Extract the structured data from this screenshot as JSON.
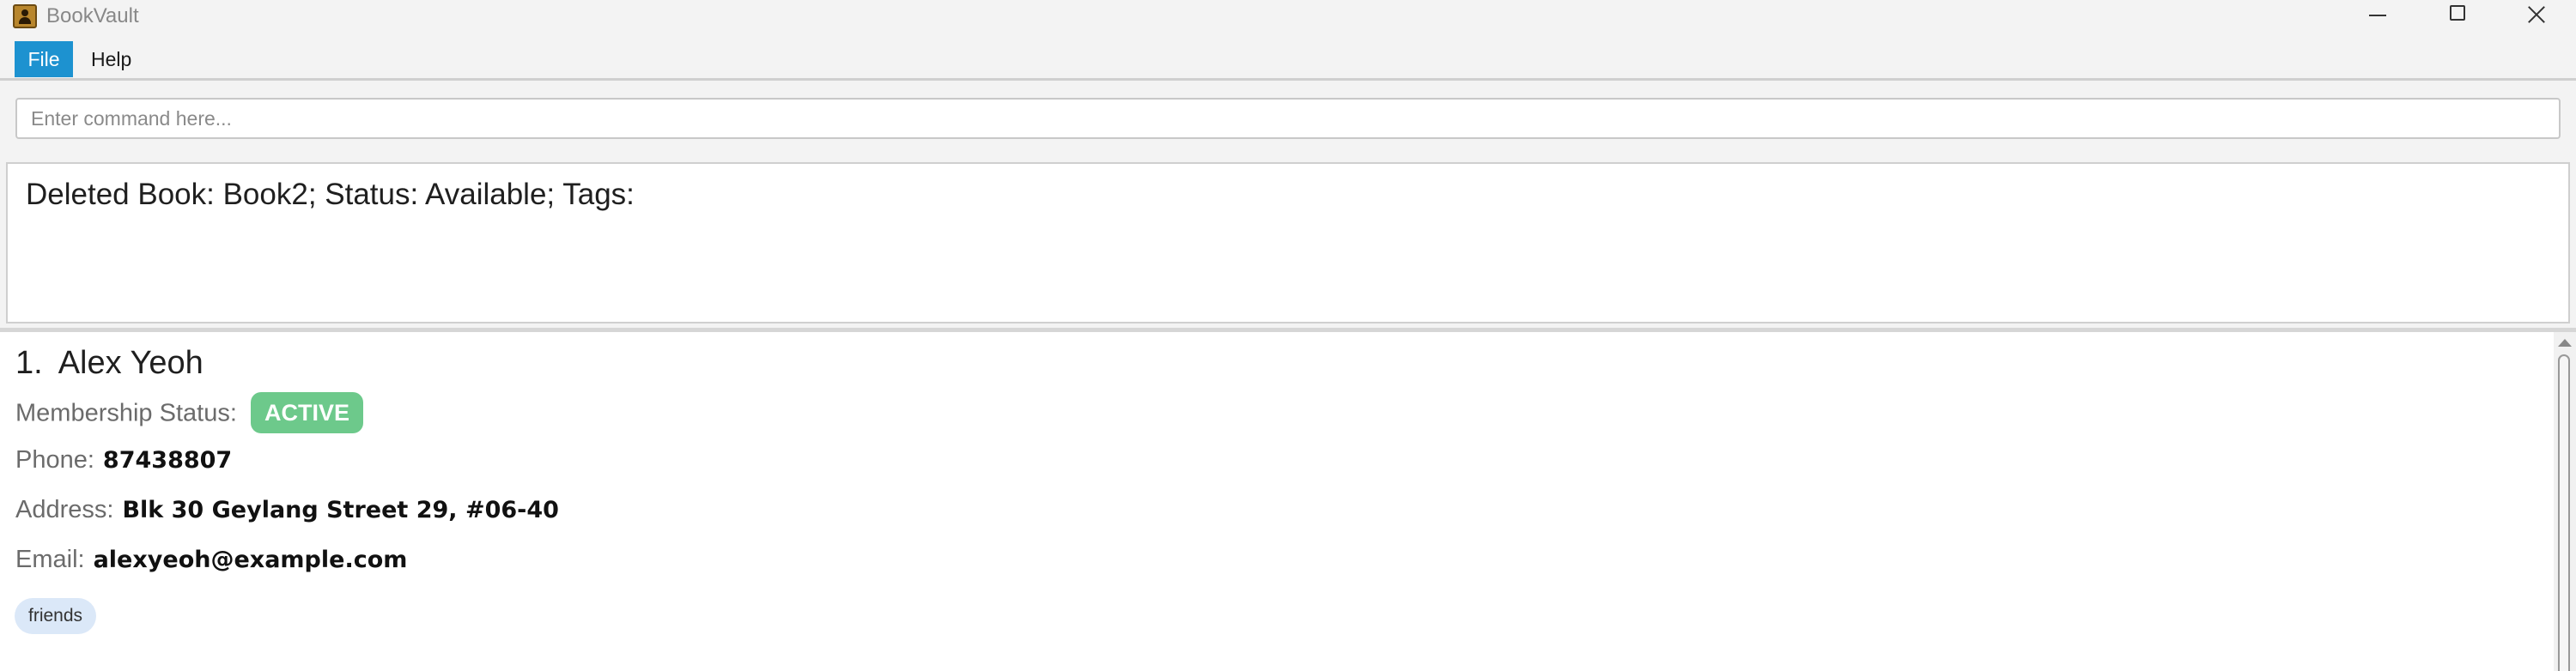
{
  "window": {
    "title": "BookVault",
    "icon": "person-book-icon"
  },
  "menu": {
    "items": [
      {
        "label": "File",
        "active": true
      },
      {
        "label": "Help",
        "active": false
      }
    ]
  },
  "command": {
    "placeholder": "Enter command here...",
    "value": ""
  },
  "result": {
    "message": "Deleted Book: Book2; Status: Available; Tags:"
  },
  "members": [
    {
      "index": "1.",
      "name": "Alex Yeoh",
      "membership_label": "Membership Status:",
      "membership_status": "ACTIVE",
      "phone_label": "Phone:",
      "phone": "87438807",
      "address_label": "Address:",
      "address": "Blk 30 Geylang Street 29, #06-40",
      "email_label": "Email:",
      "email": "alexyeoh@example.com",
      "tags": [
        "friends"
      ]
    }
  ],
  "colors": {
    "accent": "#1d92d0",
    "status_active": "#6dc98b",
    "tag_bg": "#dbe8f8"
  }
}
